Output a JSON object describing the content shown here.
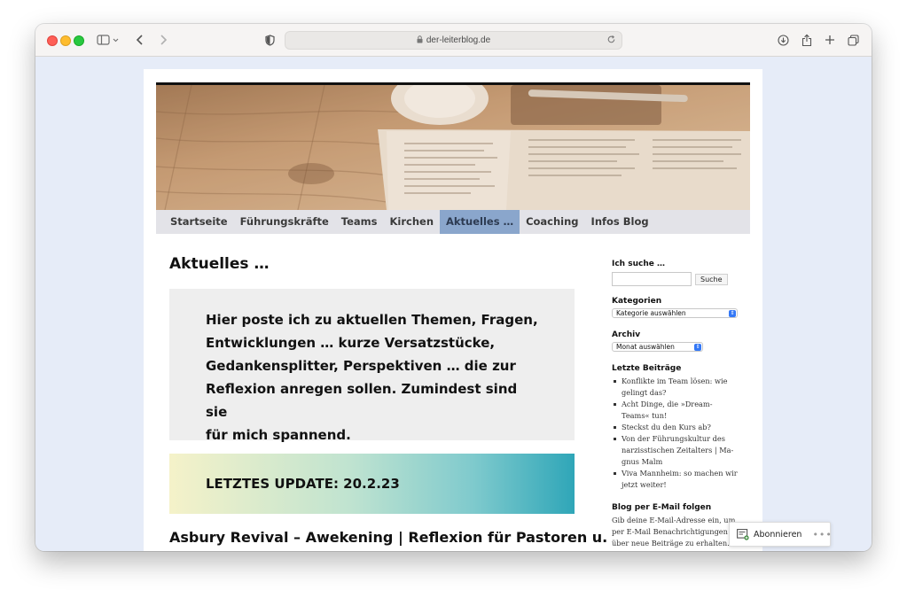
{
  "browser": {
    "url": "der-leiterblog.de"
  },
  "nav": {
    "items": [
      {
        "label": "Startseite"
      },
      {
        "label": "Führungskräfte"
      },
      {
        "label": "Teams"
      },
      {
        "label": "Kirchen"
      },
      {
        "label": "Aktuelles …",
        "active": true
      },
      {
        "label": "Coaching"
      },
      {
        "label": "Infos Blog"
      }
    ]
  },
  "main": {
    "page_title": "Aktuelles …",
    "intro_lines": [
      "Hier poste ich zu aktuellen Themen, Fragen,",
      "Entwicklungen … kurze Versatzstücke,",
      "Gedankensplitter, Perspektiven … die zur",
      "Reflexion anregen sollen. Zumindest sind sie",
      "für mich spannend."
    ],
    "update_label": "LETZTES UPDATE: 20.2.23",
    "post_title": "Asbury Revival – Awekening | Reflexion für Pastoren u."
  },
  "sidebar": {
    "search": {
      "heading": "Ich suche …",
      "button_label": "Suche"
    },
    "categories": {
      "heading": "Kategorien",
      "selected": "Kategorie auswählen"
    },
    "archive": {
      "heading": "Archiv",
      "selected": "Monat auswählen"
    },
    "recent": {
      "heading": "Letzte Beiträge",
      "posts": [
        {
          "lines": [
            "Konflikte im Team lösen: wie",
            "gelingt das?"
          ]
        },
        {
          "lines": [
            "Acht Dinge, die »Dream-",
            "Teams« tun!"
          ]
        },
        {
          "lines": [
            "Steckst du den Kurs ab?"
          ]
        },
        {
          "lines": [
            "Von der Führungskultur des",
            "narzisstischen Zeitalters | Ma-",
            "gnus Malm"
          ]
        },
        {
          "lines": [
            "Viva Mannheim: so machen wir",
            "jetzt weiter!"
          ]
        }
      ]
    },
    "follow": {
      "heading": "Blog per E-Mail folgen",
      "text_lines": [
        "Gib deine E-Mail-Adresse ein, um",
        "per E-Mail Benachrichtigungen",
        "über neue Beiträge zu erhalten."
      ]
    }
  },
  "subscribe": {
    "label": "Abonnieren",
    "more": "•••"
  }
}
